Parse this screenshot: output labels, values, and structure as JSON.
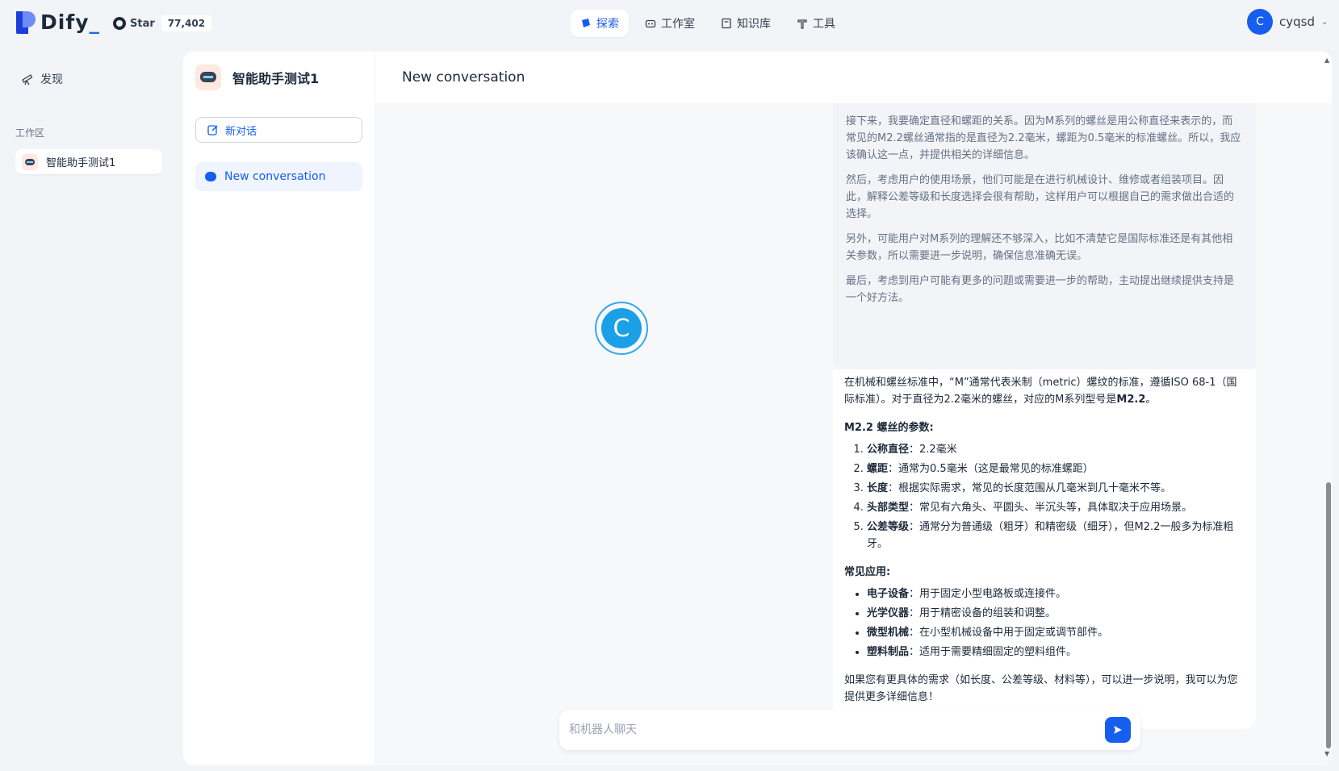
{
  "brand": {
    "name": "Dify"
  },
  "github": {
    "star_label": "Star",
    "star_count": "77,402"
  },
  "nav": {
    "items": [
      {
        "label": "探索",
        "active": true
      },
      {
        "label": "工作室",
        "active": false
      },
      {
        "label": "知识库",
        "active": false
      },
      {
        "label": "工具",
        "active": false
      }
    ]
  },
  "user": {
    "initial": "C",
    "name": "cyqsd"
  },
  "sidebar": {
    "discover_label": "发现",
    "workspace_title": "工作区",
    "app_item": "智能助手测试1"
  },
  "app": {
    "name": "智能助手测试1",
    "new_chat_label": "新对话"
  },
  "conversations": [
    {
      "label": "New conversation"
    }
  ],
  "chat": {
    "title": "New conversation",
    "thought": [
      "接下来，我要确定直径和螺距的关系。因为M系列的螺丝是用公称直径来表示的，而常见的M2.2螺丝通常指的是直径为2.2毫米，螺距为0.5毫米的标准螺丝。所以，我应该确认这一点，并提供相关的详细信息。",
      "然后，考虑用户的使用场景，他们可能是在进行机械设计、维修或者组装项目。因此，解释公差等级和长度选择会很有帮助，这样用户可以根据自己的需求做出合适的选择。",
      "另外，可能用户对M系列的理解还不够深入，比如不清楚它是国际标准还是有其他相关参数，所以需要进一步说明，确保信息准确无误。",
      "最后，考虑到用户可能有更多的问题或需要进一步的帮助，主动提出继续提供支持是一个好方法。"
    ],
    "bot_avatar": "C",
    "answer": {
      "intro_a": "在机械和螺丝标准中，“M”通常代表米制（metric）螺纹的标准，遵循ISO 68-1（国际标准）。对于直径为2.2毫米的螺丝，对应的M系列型号是",
      "intro_bold": "M2.2",
      "intro_end": "。",
      "params_heading": "M2.2 螺丝的参数:",
      "params": [
        {
          "k": "公称直径",
          "v": "：2.2毫米"
        },
        {
          "k": "螺距",
          "v": "：通常为0.5毫米（这是最常见的标准螺距）"
        },
        {
          "k": "长度",
          "v": "：根据实际需求，常见的长度范围从几毫米到几十毫米不等。"
        },
        {
          "k": "头部类型",
          "v": "：常见有六角头、平圆头、半沉头等，具体取决于应用场景。"
        },
        {
          "k": "公差等级",
          "v": "：通常分为普通级（粗牙）和精密级（细牙），但M2.2一般多为标准粗牙。"
        }
      ],
      "uses_heading": "常见应用:",
      "uses": [
        {
          "k": "电子设备",
          "v": "：用于固定小型电路板或连接件。"
        },
        {
          "k": "光学仪器",
          "v": "：用于精密设备的组装和调整。"
        },
        {
          "k": "微型机械",
          "v": "：在小型机械设备中用于固定或调节部件。"
        },
        {
          "k": "塑料制品",
          "v": "：适用于需要精细固定的塑料组件。"
        }
      ],
      "closing": "如果您有更具体的需求（如长度、公差等级、材料等），可以进一步说明，我可以为您提供更多详细信息！"
    },
    "input_placeholder": "和机器人聊天"
  },
  "colors": {
    "accent": "#155eef",
    "bg": "#f2f4f7"
  }
}
